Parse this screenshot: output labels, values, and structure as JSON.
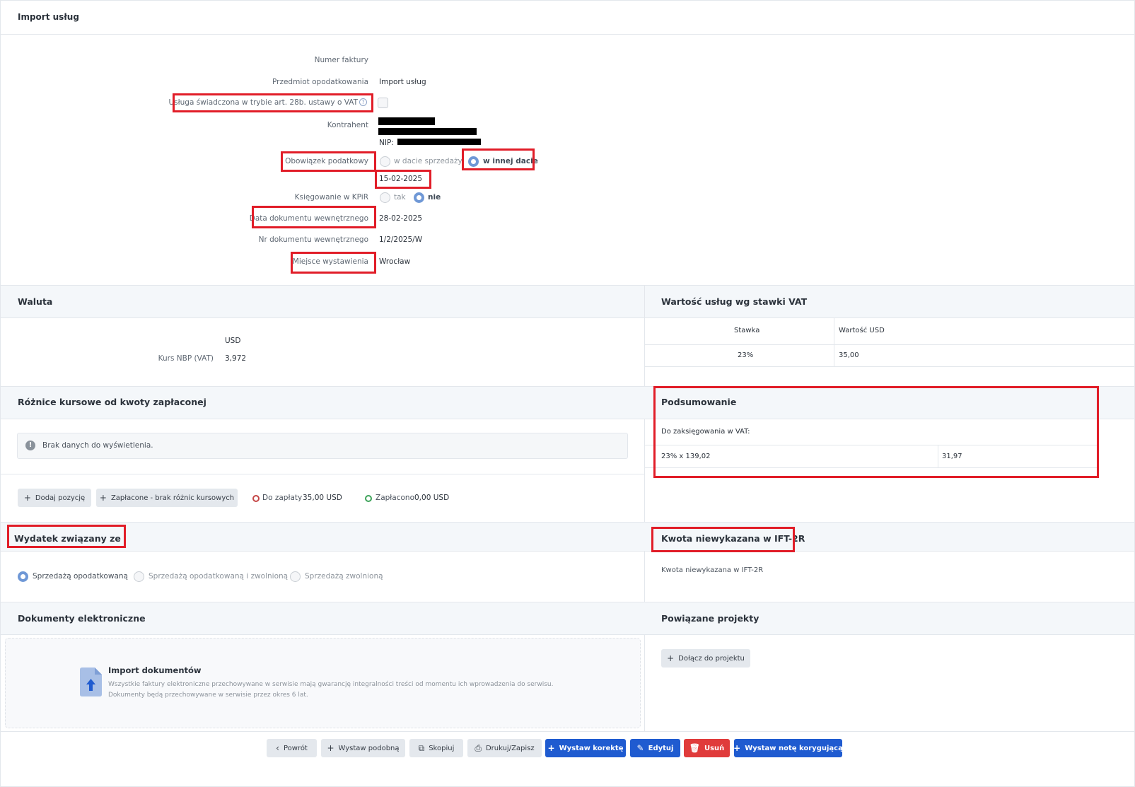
{
  "title": "Import usług",
  "form": {
    "invoice_number_label": "Numer faktury",
    "subject_label": "Przedmiot opodatkowania",
    "subject_value": "Import usług",
    "service_28b_label": "Usługa świadczona w trybie art. 28b. ustawy o VAT",
    "contractor_label": "Kontrahent",
    "nip_label": "NIP:",
    "tax_obligation_label": "Obowiązek podatkowy",
    "tax_obligation_option_sale": "w dacie sprzedaży",
    "tax_obligation_option_other": "w innej dacie",
    "tax_obligation_date": "15-02-2025",
    "kpir_label": "Księgowanie w KPiR",
    "kpir_yes": "tak",
    "kpir_no": "nie",
    "internal_doc_date_label": "Data dokumentu wewnętrznego",
    "internal_doc_date_value": "28-02-2025",
    "internal_doc_no_label": "Nr dokumentu wewnętrznego",
    "internal_doc_no_value": "1/2/2025/W",
    "place_label": "Miejsce wystawienia",
    "place_value": "Wrocław"
  },
  "currency": {
    "title": "Waluta",
    "code": "USD",
    "rate_label": "Kurs NBP (VAT)",
    "rate_value": "3,972"
  },
  "vat_values": {
    "title": "Wartość usług wg stawki VAT",
    "col_rate": "Stawka",
    "col_value": "Wartość USD",
    "rows": [
      {
        "rate": "23%",
        "value": "35,00"
      }
    ]
  },
  "exchange_diff": {
    "title": "Różnice kursowe od kwoty zapłaconej",
    "empty_text": "Brak danych do wyświetlenia.",
    "add_button": "Dodaj pozycję",
    "paid_no_diff_button": "Zapłacone - brak różnic kursowych",
    "to_pay_label": "Do zapłaty",
    "to_pay_value": "35,00 USD",
    "paid_label": "Zapłacono",
    "paid_value": "0,00 USD"
  },
  "summary": {
    "title": "Podsumowanie",
    "subtitle": "Do zaksięgowania w VAT:",
    "row_label": "23% x 139,02",
    "row_value": "31,97"
  },
  "expense": {
    "title": "Wydatek związany ze",
    "opt1": "Sprzedażą opodatkowaną",
    "opt2": "Sprzedażą opodatkowaną i zwolnioną",
    "opt3": "Sprzedażą zwolnioną"
  },
  "ift": {
    "title": "Kwota niewykazana w IFT-2R",
    "label": "Kwota niewykazana w IFT-2R"
  },
  "edocs": {
    "title": "Dokumenty elektroniczne",
    "import_title": "Import dokumentów",
    "import_line1": "Wszystkie faktury elektroniczne przechowywane w serwisie mają gwarancję integralności treści od momentu ich wprowadzenia do serwisu.",
    "import_line2": "Dokumenty będą przechowywane w serwisie przez okres 6 lat."
  },
  "projects": {
    "title": "Powiązane projekty",
    "join_button": "Dołącz do projektu"
  },
  "footer": {
    "back": "Powrót",
    "similar": "Wystaw podobną",
    "copy": "Skopiuj",
    "print": "Drukuj/Zapisz",
    "correction": "Wystaw korektę",
    "edit": "Edytuj",
    "delete": "Usuń",
    "note": "Wystaw notę korygującą"
  },
  "colors": {
    "accent_blue": "#1f5bd0",
    "danger_red": "#e03b3b",
    "highlight_red": "#e11d28",
    "radio_on": "#6f98d6"
  }
}
